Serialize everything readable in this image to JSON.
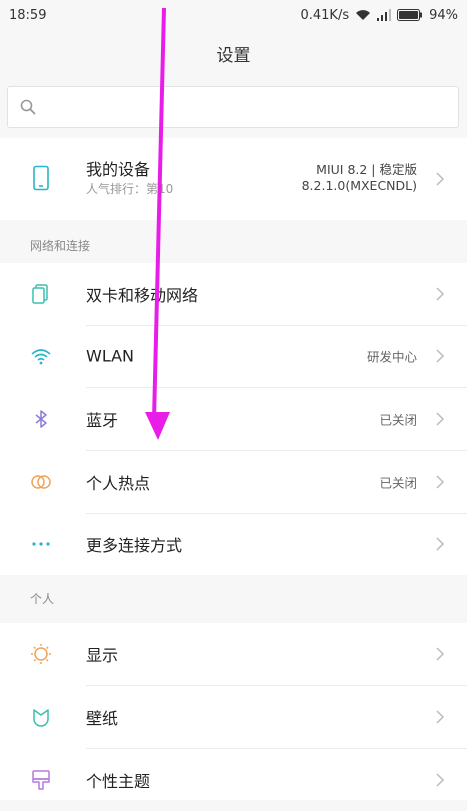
{
  "status_bar": {
    "time": "18:59",
    "net_speed": "0.41K/s",
    "battery": "94%"
  },
  "title": "设置",
  "search": {
    "placeholder": "",
    "value": ""
  },
  "device": {
    "name": "我的设备",
    "subtitle": "人气排行：第10",
    "version_line1": "MIUI 8.2 | 稳定版",
    "version_line2": "8.2.1.0(MXECNDL)"
  },
  "sections": {
    "network": {
      "header": "网络和连接",
      "items": [
        {
          "label": "双卡和移动网络",
          "value": "",
          "icon": "sim-cards-icon",
          "color": "#3bbfad"
        },
        {
          "label": "WLAN",
          "value": "研发中心",
          "icon": "wifi-icon",
          "color": "#29b6c8"
        },
        {
          "label": "蓝牙",
          "value": "已关闭",
          "icon": "bluetooth-icon",
          "color": "#8b7cd8"
        },
        {
          "label": "个人热点",
          "value": "已关闭",
          "icon": "hotspot-icon",
          "color": "#f0a35a"
        },
        {
          "label": "更多连接方式",
          "value": "",
          "icon": "more-dots-icon",
          "color": "#2fb3c9"
        }
      ]
    },
    "personal": {
      "header": "个人",
      "items": [
        {
          "label": "显示",
          "value": "",
          "icon": "sun-icon",
          "color": "#f0a35a"
        },
        {
          "label": "壁纸",
          "value": "",
          "icon": "wallpaper-icon",
          "color": "#3bbfad"
        },
        {
          "label": "个性主题",
          "value": "",
          "icon": "theme-brush-icon",
          "color": "#b57ae0"
        }
      ]
    }
  },
  "annotation_arrow_color": "#e81ee8"
}
